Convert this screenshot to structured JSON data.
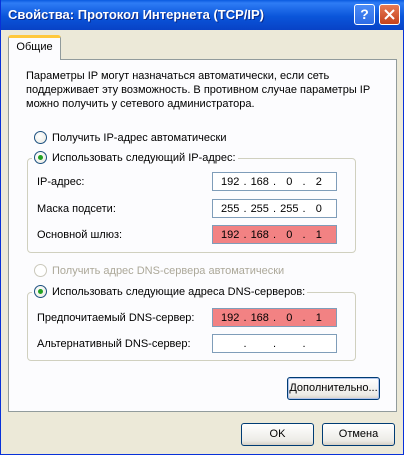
{
  "window": {
    "title": "Свойства: Протокол Интернета (TCP/IP)",
    "help_glyph": "?"
  },
  "tabs": [
    {
      "label": "Общие"
    }
  ],
  "intro_text": "Параметры IP могут назначаться автоматически, если сеть поддерживает эту возможность. В противном случае параметры IP можно получить у сетевого администратора.",
  "ip_mode": {
    "auto_label": "Получить IP-адрес автоматически",
    "manual_label": "Использовать следующий IP-адрес:",
    "selected": "manual"
  },
  "ip_fields": {
    "ip_label": "IP-адрес:",
    "mask_label": "Маска подсети:",
    "gateway_label": "Основной шлюз:",
    "ip": [
      "192",
      "168",
      "0",
      "2"
    ],
    "mask": [
      "255",
      "255",
      "255",
      "0"
    ],
    "gateway": [
      "192",
      "168",
      "0",
      "1"
    ]
  },
  "dns_mode": {
    "auto_label": "Получить адрес DNS-сервера автоматически",
    "manual_label": "Использовать следующие адреса DNS-серверов:",
    "selected": "manual"
  },
  "dns_fields": {
    "preferred_label": "Предпочитаемый DNS-сервер:",
    "alternate_label": "Альтернативный DNS-сервер:",
    "preferred": [
      "192",
      "168",
      "0",
      "1"
    ],
    "alternate": [
      "",
      "",
      "",
      ""
    ]
  },
  "buttons": {
    "advanced": "Дополнительно...",
    "ok": "OK",
    "cancel": "Отмена"
  },
  "colors": {
    "titlebar": "#0A55DA",
    "highlight": "#F28283",
    "tab_accent": "#FFC83C",
    "face": "#ECE9D8"
  }
}
